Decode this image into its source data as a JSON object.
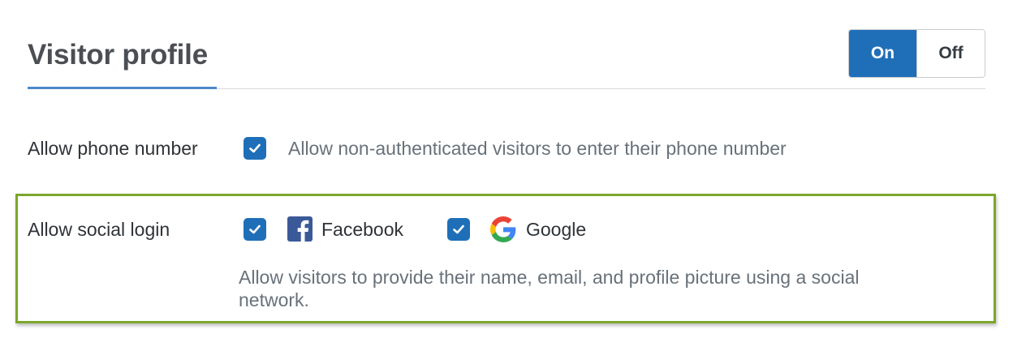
{
  "header": {
    "title": "Visitor profile",
    "toggle": {
      "on_label": "On",
      "off_label": "Off",
      "selected": "On"
    }
  },
  "phone_row": {
    "label": "Allow phone number",
    "checked": true,
    "description": "Allow non-authenticated visitors to enter their phone number"
  },
  "social_row": {
    "label": "Allow social login",
    "options": [
      {
        "label": "Facebook",
        "checked": true,
        "icon": "facebook-icon"
      },
      {
        "label": "Google",
        "checked": true,
        "icon": "google-icon"
      }
    ],
    "description_line1": "Allow visitors to provide their name, email, and profile picture using a social",
    "description_line2": "network."
  },
  "colors": {
    "accent": "#1f6fb8",
    "highlight_border": "#7aa72a",
    "facebook": "#3b5998"
  }
}
